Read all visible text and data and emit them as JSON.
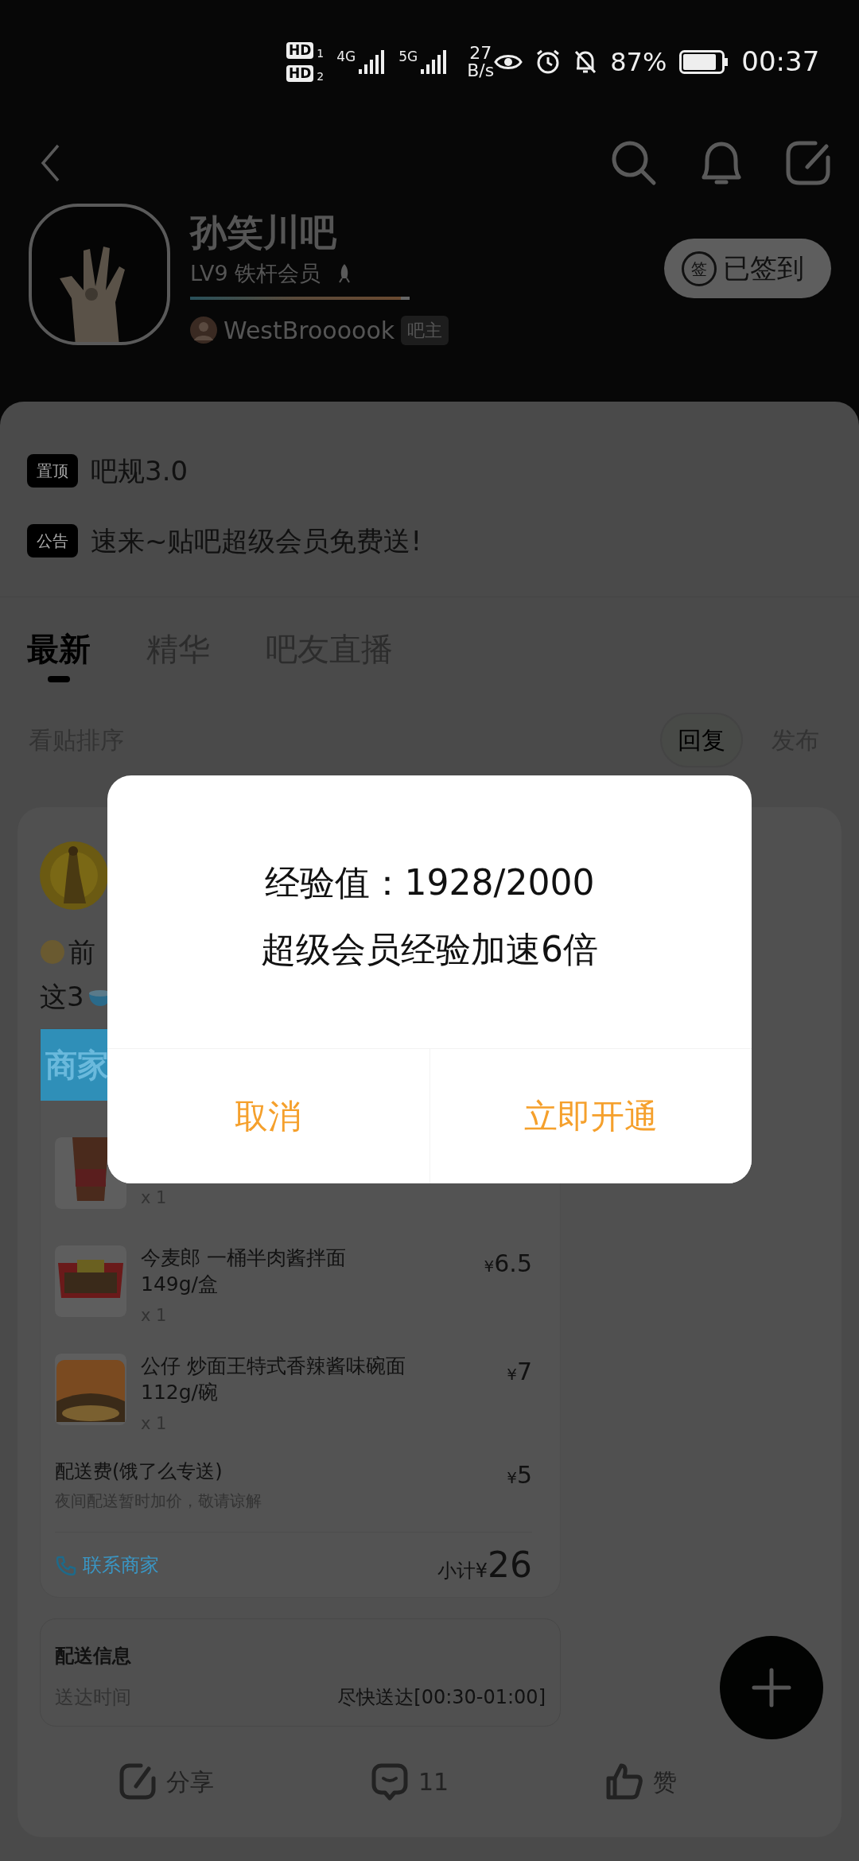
{
  "status_bar": {
    "sims": [
      {
        "label": "HD",
        "slot": "1"
      },
      {
        "label": "HD",
        "slot": "2"
      }
    ],
    "networks": [
      "4G",
      "5G"
    ],
    "speed": "27",
    "speed_unit": "B/s",
    "battery": "87%",
    "time": "00:37"
  },
  "forum": {
    "name": "孙笑川吧",
    "level": "LV9",
    "member_title": "铁杆会员",
    "progress": {
      "level": 0.96
    },
    "owner": {
      "name": "WestBroooook",
      "role": "吧主"
    },
    "checkin": {
      "icon_text": "签",
      "label": "已签到"
    }
  },
  "notices": [
    {
      "tag": "置顶",
      "text": "吧规3.0"
    },
    {
      "tag": "公告",
      "text": "速来~贴吧超级会员免费送!"
    }
  ],
  "tabs": [
    {
      "label": "最新",
      "selected": true
    },
    {
      "label": "精华",
      "selected": false
    },
    {
      "label": "吧友直播",
      "selected": false
    }
  ],
  "sort": {
    "label": "看贴排序",
    "options": [
      {
        "label": "回复",
        "selected": true
      },
      {
        "label": "发布",
        "selected": false
      }
    ]
  },
  "post": {
    "lines": [
      "前",
      "这3"
    ],
    "order": {
      "merchant_header": "商家",
      "items": [
        {
          "quantity": "x 1"
        },
        {
          "name": "今麦郎 一桶半肉酱拌面 149g/盒",
          "currency": "¥",
          "price": "6.5",
          "quantity": "x 1"
        },
        {
          "name": "公仔 炒面王特式香辣酱味碗面 112g/碗",
          "currency": "¥",
          "price": "7",
          "quantity": "x 1"
        }
      ],
      "fee": {
        "label": "配送费(饿了么专送)",
        "note": "夜间配送暂时加价，敬请谅解",
        "currency": "¥",
        "price": "5"
      },
      "contact": "联系商家",
      "subtotal_label": "小计",
      "subtotal_currency": "¥",
      "subtotal": "26"
    },
    "delivery": {
      "title": "配送信息",
      "label": "送达时间",
      "value": "尽快送达[00:30-01:00]"
    },
    "actions": [
      {
        "kind": "share",
        "label": "分享"
      },
      {
        "kind": "comment",
        "label": "11"
      },
      {
        "kind": "like",
        "label": "赞"
      }
    ]
  },
  "dialog": {
    "lines": [
      "经验值：1928/2000",
      "超级会员经验加速6倍"
    ],
    "buttons": [
      {
        "label": "取消"
      },
      {
        "label": "立即开通"
      }
    ]
  }
}
